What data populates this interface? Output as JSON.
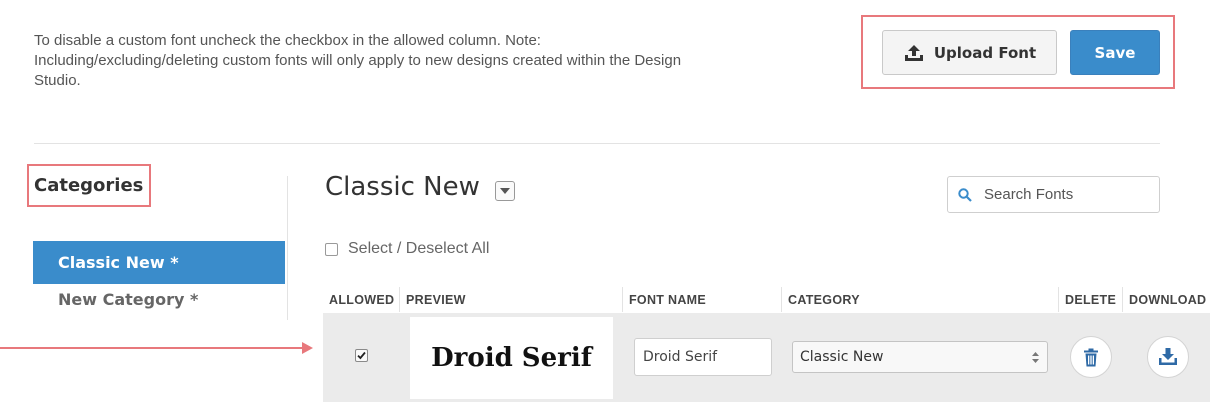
{
  "intro": {
    "line1": "To disable a custom font uncheck the checkbox in the allowed column. Note:",
    "line2": "Including/excluding/deleting custom fonts will only apply to new designs created within the Design",
    "line3": "Studio."
  },
  "toolbar": {
    "upload_label": "Upload Font",
    "save_label": "Save"
  },
  "categories": {
    "heading": "Categories",
    "items": [
      {
        "label": "Classic New *",
        "active": true
      },
      {
        "label": "New Category *",
        "active": false
      }
    ]
  },
  "main": {
    "title": "Classic New",
    "search_placeholder": "Search Fonts",
    "select_all_label": "Select / Deselect All"
  },
  "table": {
    "headers": [
      "ALLOWED",
      "PREVIEW",
      "FONT NAME",
      "CATEGORY",
      "DELETE",
      "DOWNLOAD"
    ],
    "rows": [
      {
        "allowed": true,
        "preview": "Droid Serif",
        "font_name": "Droid Serif",
        "category": "Classic New"
      }
    ]
  },
  "colors": {
    "accent": "#3a8ccb",
    "highlight": "#e8787c",
    "icon_blue": "#2f6aa6"
  },
  "icons": {
    "upload": "upload-icon",
    "search": "search-icon",
    "dropdown": "caret-down-icon",
    "delete": "trash-icon",
    "download": "download-icon",
    "select": "updown-caret-icon"
  }
}
